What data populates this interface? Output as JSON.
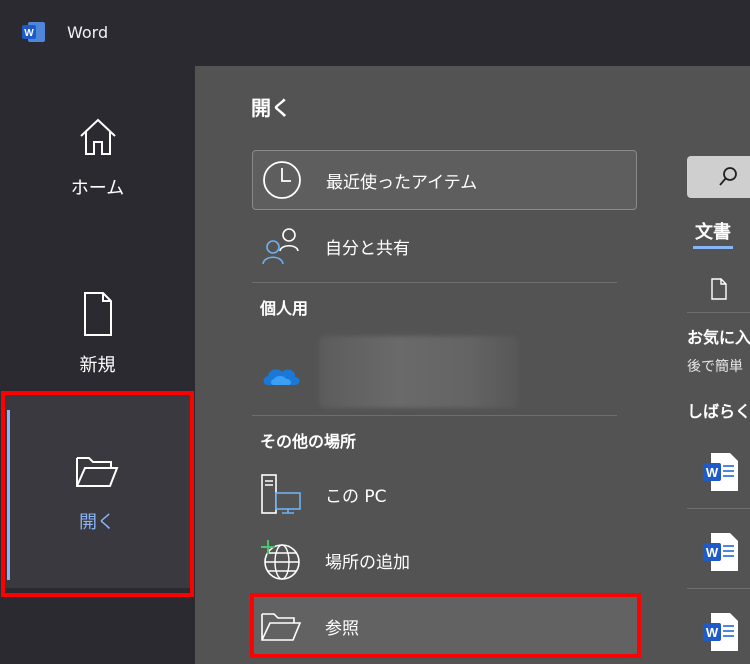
{
  "app": {
    "name": "Word"
  },
  "sidebar": {
    "items": [
      {
        "label": "ホーム",
        "icon": "home-icon"
      },
      {
        "label": "新規",
        "icon": "new-document-icon"
      },
      {
        "label": "開く",
        "icon": "folder-open-icon",
        "selected": true
      }
    ]
  },
  "main": {
    "title": "開く",
    "locations": {
      "recent": "最近使ったアイテム",
      "shared": "自分と共有",
      "pc": "この PC",
      "add_place": "場所の追加",
      "browse": "参照"
    },
    "sections": {
      "personal": "個人用",
      "other": "その他の場所"
    }
  },
  "right_panel": {
    "tab": "文書",
    "favorites_title": "お気に入",
    "favorites_sub": "後で簡単",
    "recent_title": "しばらく前"
  },
  "colors": {
    "accent": "#8ab4f8",
    "highlight": "#ff0000",
    "background": "#2b2a30",
    "panel": "#535353"
  }
}
